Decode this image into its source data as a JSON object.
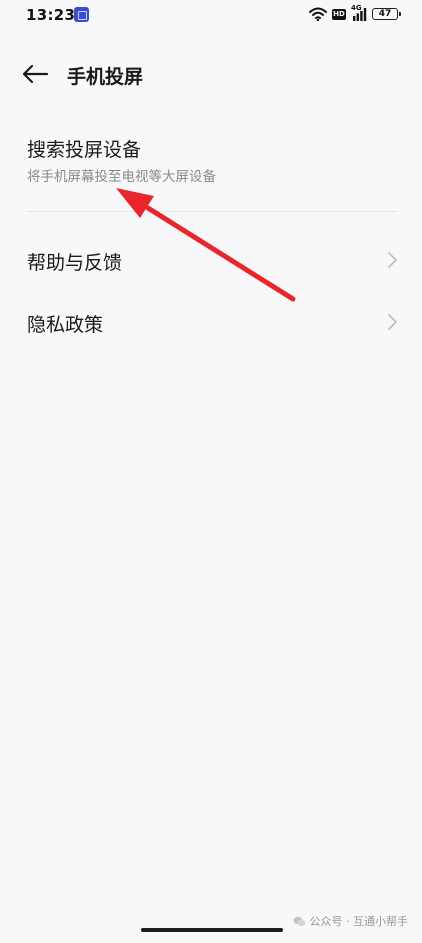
{
  "status_bar": {
    "time": "13:23",
    "hd_label": "HD",
    "network_label": "4G",
    "battery_level": "47",
    "icons": [
      "app-notification-icon",
      "wifi-icon",
      "signal-icon",
      "battery-icon"
    ]
  },
  "header": {
    "back_icon": "arrow-left-icon",
    "title": "手机投屏"
  },
  "list": {
    "search_devices": {
      "title": "搜索投屏设备",
      "subtitle": "将手机屏幕投至电视等大屏设备"
    },
    "help_feedback": {
      "title": "帮助与反馈",
      "chevron_icon": "chevron-right-icon"
    },
    "privacy_policy": {
      "title": "隐私政策",
      "chevron_icon": "chevron-right-icon"
    }
  },
  "annotation": {
    "arrow_color": "#e8262b"
  },
  "watermark": {
    "text": "公众号 · 互通小帮手",
    "icon": "wechat-icon"
  },
  "colors": {
    "background": "#f8f8fa",
    "title_text": "#1a1a1a",
    "subtitle_text": "#8a8a8a",
    "chevron": "#bdbdbd",
    "arrow": "#e8262b"
  }
}
